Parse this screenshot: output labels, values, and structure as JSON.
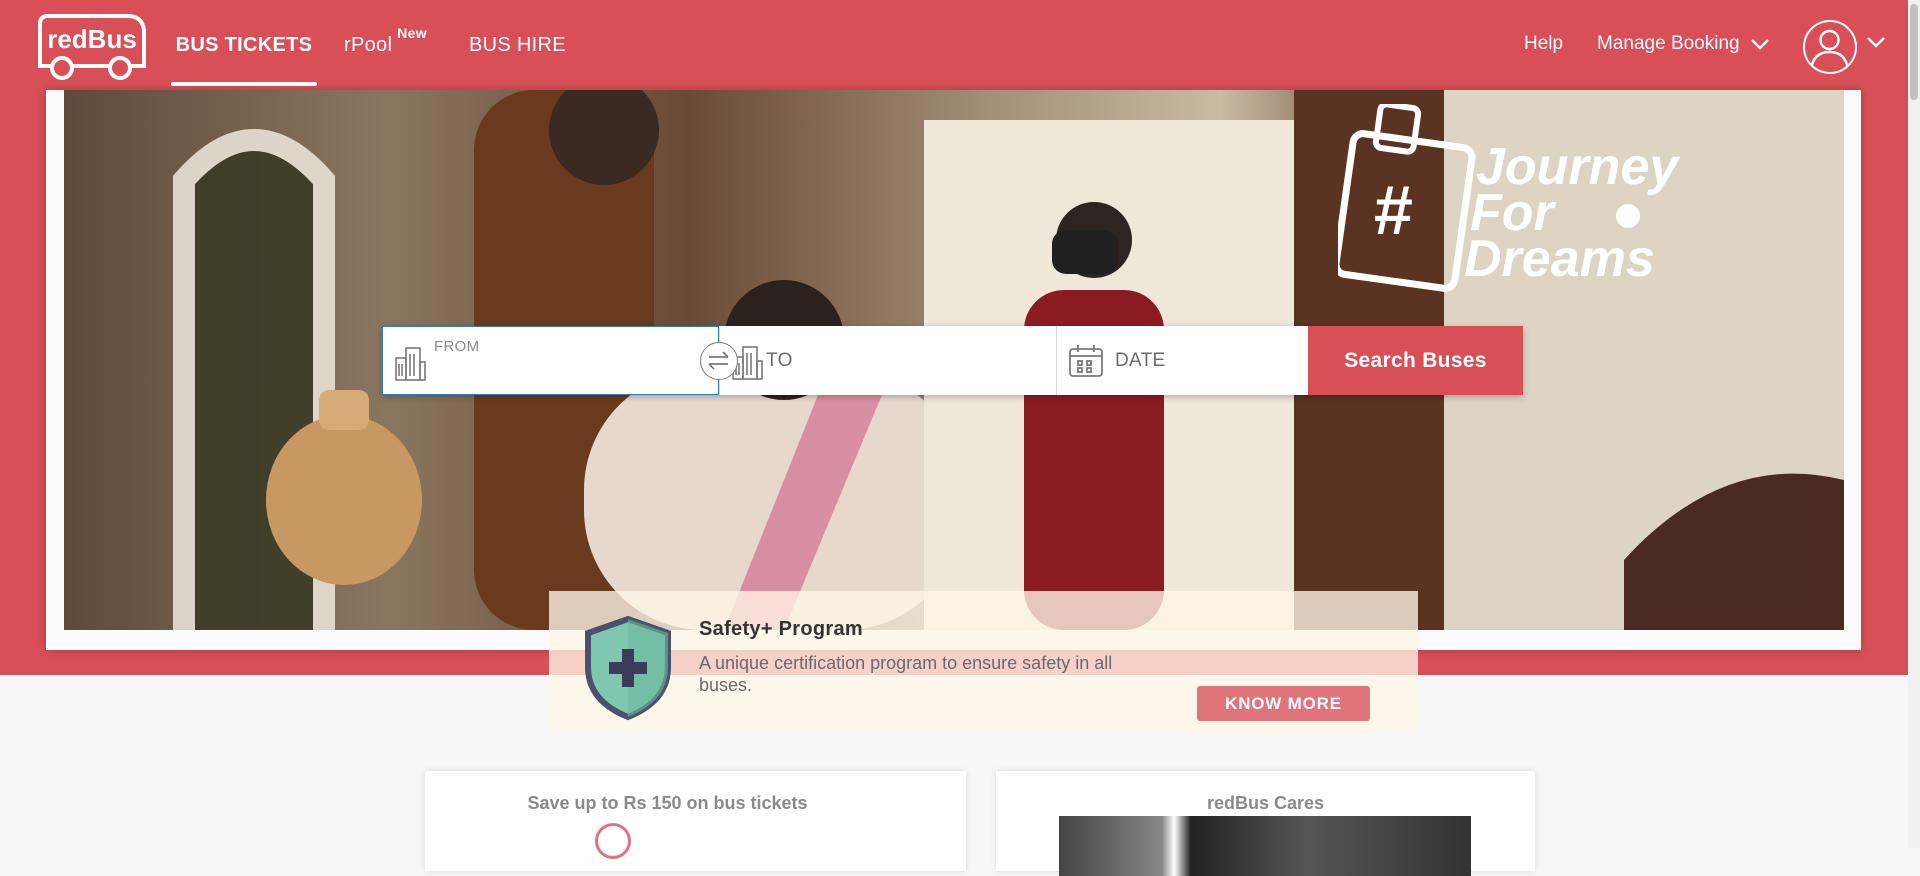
{
  "header": {
    "logo_text": "redBus",
    "tabs": [
      {
        "label": "BUS TICKETS",
        "active": true
      },
      {
        "label": "rPool",
        "badge": "New"
      },
      {
        "label": "BUS HIRE"
      }
    ],
    "help_label": "Help",
    "manage_booking_label": "Manage Booking",
    "icons": [
      "user-avatar-icon",
      "chevron-down-icon"
    ]
  },
  "hero": {
    "slogan": [
      "#",
      "Journey",
      "For",
      "Dreams"
    ]
  },
  "search": {
    "from_label": "FROM",
    "to_label": "TO",
    "date_label": "DATE",
    "button_label": "Search Buses",
    "icons": [
      "city-building-icon",
      "swap-icon",
      "calendar-icon"
    ]
  },
  "safety": {
    "title": "Safety+ Program",
    "description": "A unique certification program to ensure safety in all buses.",
    "button_label": "KNOW MORE"
  },
  "cards": [
    {
      "title": "Save up to Rs 150 on bus tickets"
    },
    {
      "title": "redBus Cares"
    }
  ],
  "colors": {
    "brand": "#d84f57",
    "button_secondary": "#e0747b",
    "shield_fill": "#7fc7ae",
    "shield_border": "#4b506e"
  }
}
